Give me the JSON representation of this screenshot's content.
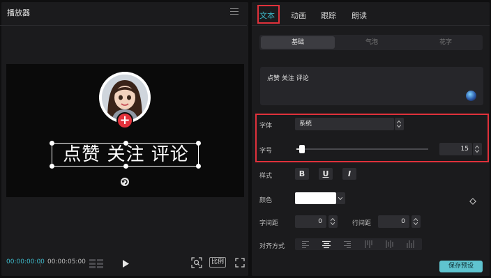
{
  "player": {
    "title": "播放器",
    "caption": "点赞 关注 评论",
    "timecode_current": "00:00:00:00",
    "timecode_total": "00:00:05:00",
    "ratio_label": "比例"
  },
  "tabs": [
    {
      "label": "文本",
      "active": true
    },
    {
      "label": "动画"
    },
    {
      "label": "跟踪"
    },
    {
      "label": "朗读"
    }
  ],
  "subtabs": [
    {
      "label": "基础",
      "active": true
    },
    {
      "label": "气泡"
    },
    {
      "label": "花字"
    }
  ],
  "text_input": {
    "value": "点赞 关注 评论"
  },
  "font": {
    "label": "字体",
    "value": "系统"
  },
  "font_size": {
    "label": "字号",
    "value": "15",
    "slider_fraction": 0.04
  },
  "style": {
    "label": "样式",
    "buttons": [
      "B",
      "U",
      "I"
    ]
  },
  "color": {
    "label": "颜色",
    "value": "#ffffff"
  },
  "spacing": {
    "char_label": "字间距",
    "char_value": "0",
    "line_label": "行间距",
    "line_value": "0"
  },
  "align": {
    "label": "对齐方式"
  },
  "save_preset_label": "保存预设",
  "colors": {
    "accent": "#3ebbcc",
    "highlight": "#e0313b",
    "badge": "#e2323c",
    "button": "#5fc3cf"
  }
}
